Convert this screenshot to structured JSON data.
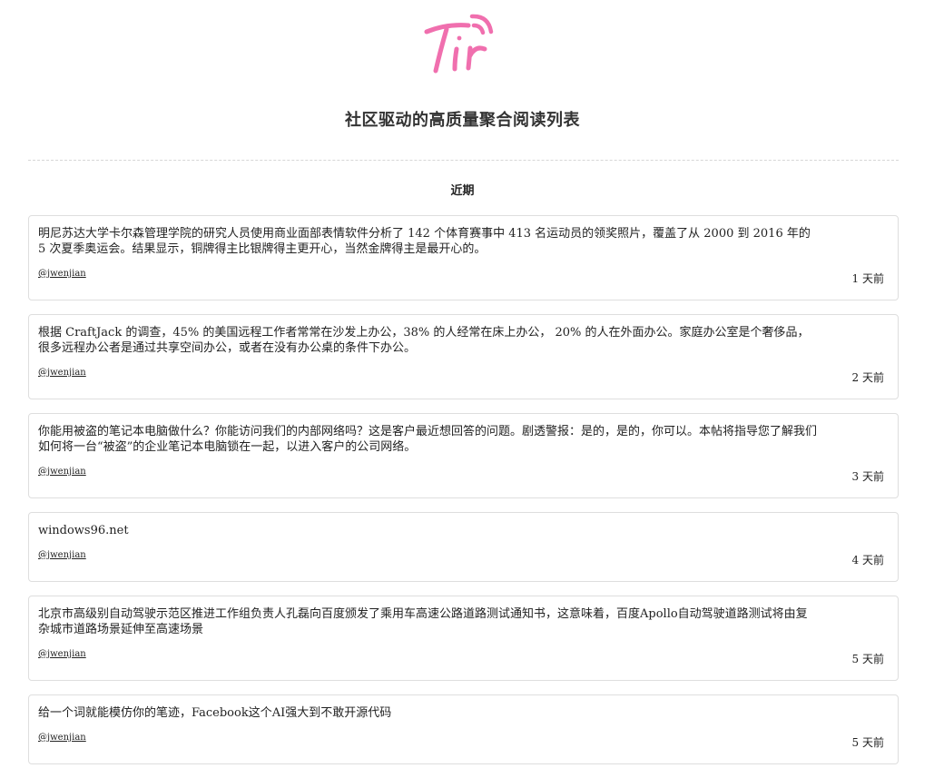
{
  "header": {
    "logo_text": "Tir",
    "tagline": "社区驱动的高质量聚合阅读列表"
  },
  "section": {
    "title": "近期"
  },
  "items": [
    {
      "text": "明尼苏达大学卡尔森管理学院的研究人员使用商业面部表情软件分析了 142 个体育赛事中 413 名运动员的领奖照片，覆盖了从 2000 到 2016 年的 5 次夏季奥运会。结果显示，铜牌得主比银牌得主更开心，当然金牌得主是最开心的。",
      "author": "@jwenjian",
      "time": "1 天前"
    },
    {
      "text": "根据 CraftJack 的调查，45% 的美国远程工作者常常在沙发上办公，38% 的人经常在床上办公， 20% 的人在外面办公。家庭办公室是个奢侈品，很多远程办公者是通过共享空间办公，或者在没有办公桌的条件下办公。",
      "author": "@jwenjian",
      "time": "2 天前"
    },
    {
      "text": "你能用被盗的笔记本电脑做什么？你能访问我们的内部网络吗？这是客户最近想回答的问题。剧透警报：是的，是的，你可以。本帖将指导您了解我们如何将一台“被盗”的企业笔记本电脑锁在一起，以进入客户的公司网络。",
      "author": "@jwenjian",
      "time": "3 天前"
    },
    {
      "text": "windows96.net",
      "author": "@jwenjian",
      "time": "4 天前"
    },
    {
      "text": "北京市高级别自动驾驶示范区推进工作组负责人孔磊向百度颁发了乘用车高速公路道路测试通知书，这意味着，百度Apollo自动驾驶道路测试将由复杂城市道路场景延伸至高速场景",
      "author": "@jwenjian",
      "time": "5 天前"
    },
    {
      "text": "给一个词就能模仿你的笔迹，Facebook这个AI强大到不敢开源代码",
      "author": "@jwenjian",
      "time": "5 天前"
    }
  ],
  "colors": {
    "logo_pink": "#f06fae",
    "card_border": "#dedede"
  }
}
